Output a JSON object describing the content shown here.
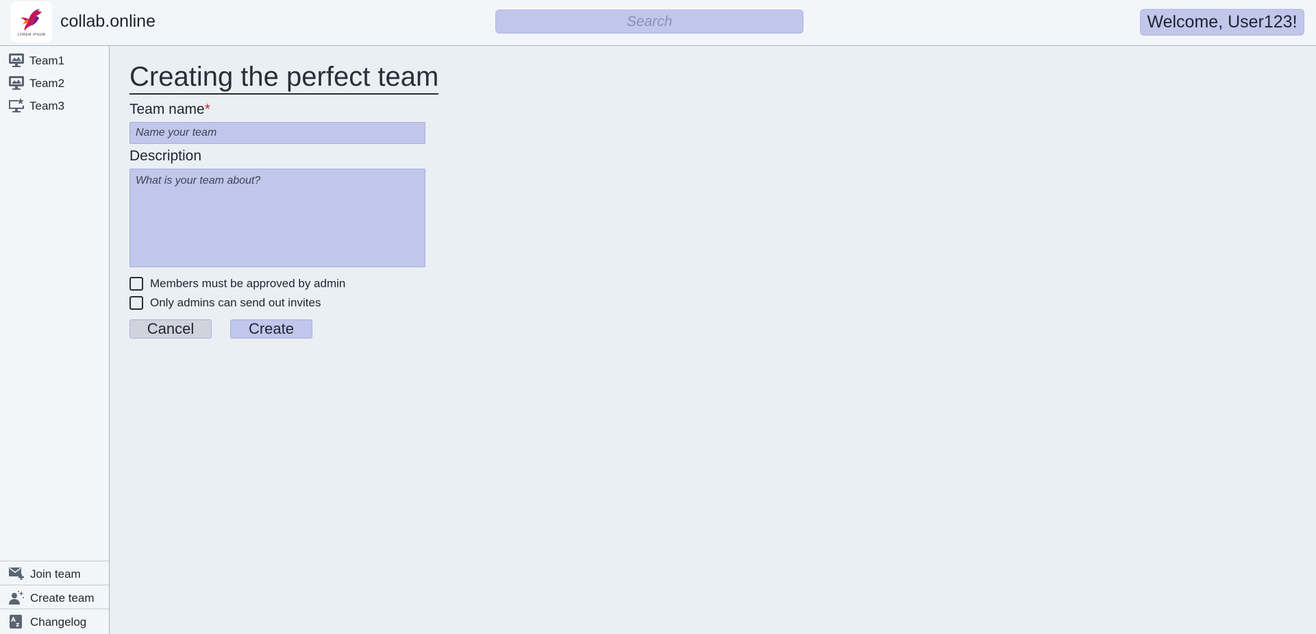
{
  "header": {
    "site_title": "collab.online",
    "logo_caption": "LOREM IPSUM",
    "search_placeholder": "Search",
    "welcome": "Welcome, User123!"
  },
  "sidebar": {
    "teams": [
      {
        "label": "Team1",
        "icon": "presentation-icon"
      },
      {
        "label": "Team2",
        "icon": "presentation-icon"
      },
      {
        "label": "Team3",
        "icon": "monitor-star-icon"
      }
    ],
    "bottom_items": [
      {
        "label": "Join team",
        "icon": "mail-plus-icon"
      },
      {
        "label": "Create team",
        "icon": "user-sparkle-icon"
      },
      {
        "label": "Changelog",
        "icon": "az-document-icon"
      }
    ]
  },
  "form": {
    "title": "Creating the perfect team",
    "team_name_label": "Team name",
    "required_marker": "*",
    "team_name_placeholder": "Name your team",
    "team_name_value": "",
    "description_label": "Description",
    "description_placeholder": "What is your team about?",
    "description_value": "",
    "options": [
      {
        "label": "Members must be approved by admin",
        "checked": false
      },
      {
        "label": "Only admins can send out invites",
        "checked": false
      }
    ],
    "cancel_label": "Cancel",
    "create_label": "Create"
  },
  "colors": {
    "accent": "#c1c6eb",
    "background": "#eaeff4",
    "panel": "#f3f6f9",
    "required": "#d42a2a"
  }
}
